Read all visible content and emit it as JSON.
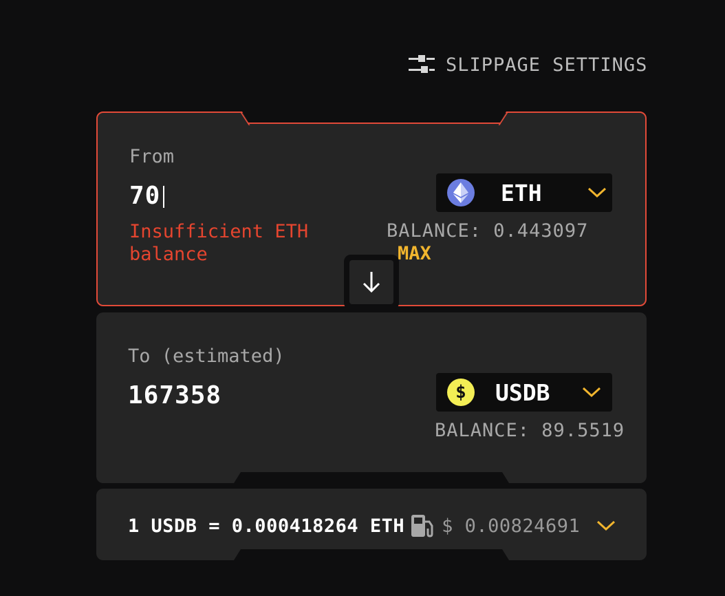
{
  "slippage": {
    "label": "SLIPPAGE SETTINGS",
    "icon": "sliders-icon"
  },
  "from": {
    "label": "From",
    "amount": "70",
    "error": "Insufficient ETH balance",
    "token": "ETH",
    "balance_label": "BALANCE: 0.443097",
    "max_label": "MAX"
  },
  "to": {
    "label": "To (estimated)",
    "amount": "167358",
    "token": "USDB",
    "usdb_symbol": "$",
    "balance_label": "BALANCE: 89.5519"
  },
  "rate": {
    "text": "1 USDB = 0.000418264 ETH",
    "gas_value": "$ 0.00824691"
  },
  "colors": {
    "accent": "#f1b52e",
    "error": "#e5452f",
    "border_error": "#e24a38",
    "card": "#252525",
    "background": "#0e0e0f"
  }
}
